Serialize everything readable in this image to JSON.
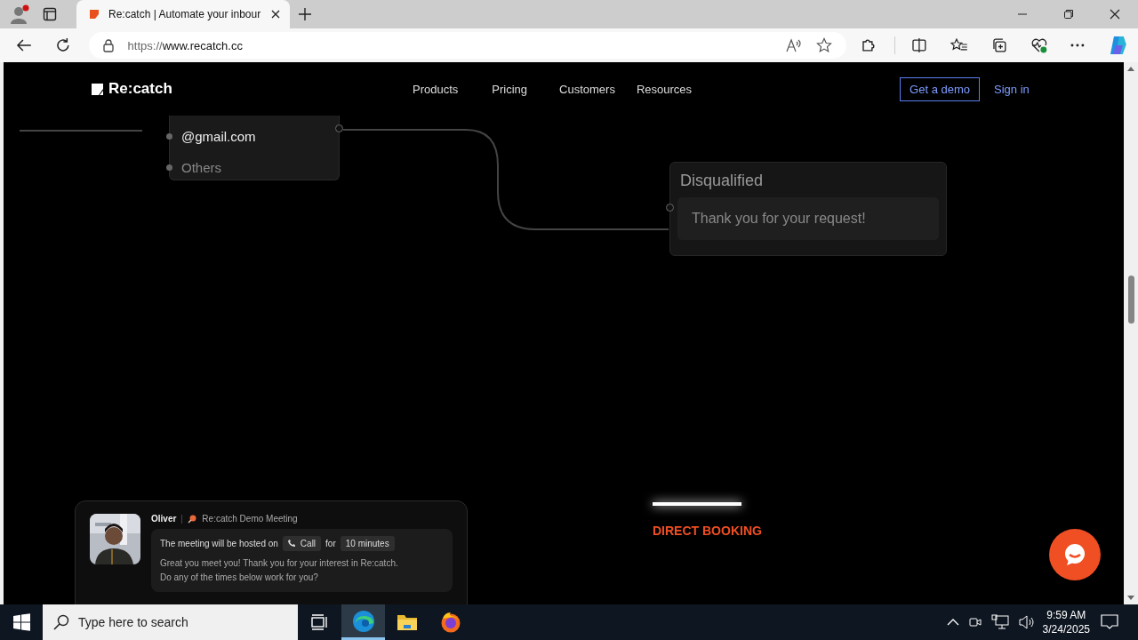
{
  "browser": {
    "tab": {
      "title": "Re:catch | Automate your inbour",
      "selected": true
    },
    "address": {
      "scheme": "https://",
      "host": "www.recatch.cc"
    }
  },
  "nav": {
    "logo": "Re:catch",
    "links": [
      "Products",
      "Pricing",
      "Customers",
      "Resources"
    ],
    "demo_button": "Get a demo",
    "signin_link": "Sign in"
  },
  "flow": {
    "options": [
      {
        "label": "@gmail.com",
        "selected": true
      },
      {
        "label": "Others",
        "selected": false
      }
    ],
    "result_node": {
      "title": "Disqualified",
      "message": "Thank you for your request!"
    }
  },
  "meeting_card": {
    "host": "Oliver",
    "meeting": "Re:catch Demo Meeting",
    "hosted_on": "The meeting will be hosted on",
    "channel": "Call",
    "for": "for",
    "duration": "10 minutes",
    "message_lines": [
      "Great you meet you! Thank you for your interest in Re:catch.",
      "Do any of the times below work for you?"
    ]
  },
  "section_label": "DIRECT BOOKING",
  "taskbar": {
    "search": {
      "placeholder": "Type here to search"
    },
    "apps": [
      {
        "kind": "taskview",
        "selected": false
      },
      {
        "kind": "edge",
        "selected": true
      },
      {
        "kind": "explorer",
        "selected": false
      },
      {
        "kind": "firefox",
        "selected": false
      }
    ],
    "time": "9:59 AM",
    "date": "3/24/2025"
  }
}
